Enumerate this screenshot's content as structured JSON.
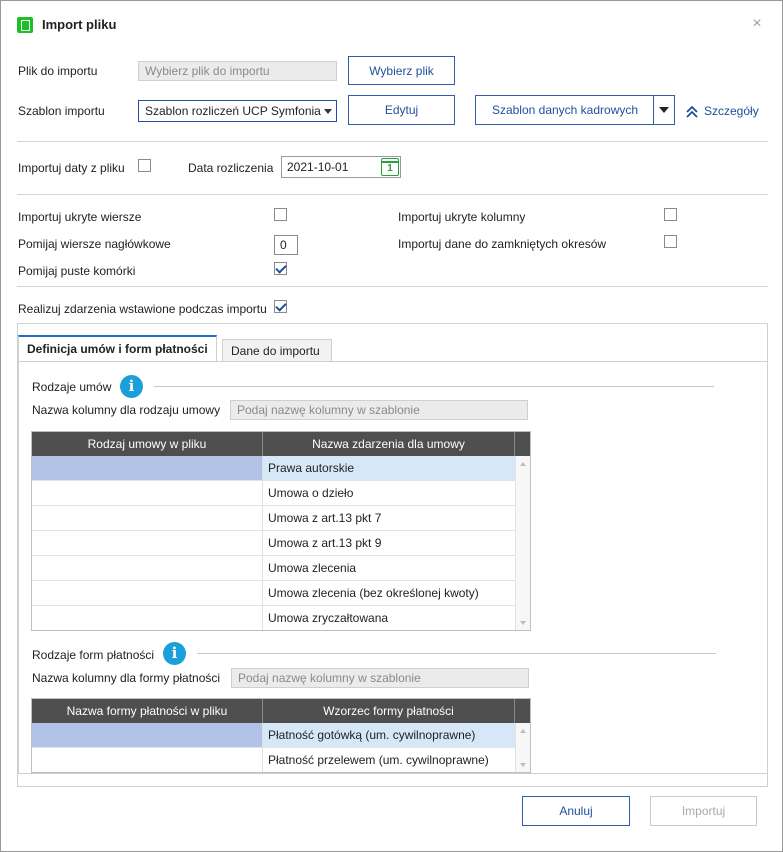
{
  "window": {
    "title": "Import pliku",
    "close_glyph": "×",
    "icon": "app-import-icon"
  },
  "file": {
    "label": "Plik do importu",
    "placeholder": "Wybierz plik do importu",
    "choose_button": "Wybierz plik"
  },
  "template": {
    "label": "Szablon importu",
    "selected": "Szablon rozliczeń UCP Symfonia",
    "edit_button": "Edytuj",
    "hr_template_button": "Szablon danych kadrowych",
    "details_link": "Szczegóły"
  },
  "dates": {
    "import_dates_label": "Importuj daty z pliku",
    "import_dates_checked": false,
    "settlement_date_label": "Data rozliczenia",
    "settlement_date": "2021-10-01",
    "calendar_day": "1"
  },
  "options": {
    "hidden_rows_label": "Importuj ukryte wiersze",
    "hidden_rows_checked": false,
    "hidden_columns_label": "Importuj ukryte kolumny",
    "hidden_columns_checked": false,
    "skip_header_rows_label": "Pomijaj wiersze nagłówkowe",
    "skip_header_rows_value": "0",
    "closed_periods_label": "Importuj dane do zamkniętych okresów",
    "closed_periods_checked": false,
    "skip_empty_cells_label": "Pomijaj puste komórki",
    "skip_empty_cells_checked": true,
    "realize_events_label": "Realizuj zdarzenia wstawione podczas importu",
    "realize_events_checked": true
  },
  "tabs": [
    {
      "label": "Definicja umów i form płatności",
      "active": true
    },
    {
      "label": "Dane do importu",
      "active": false
    }
  ],
  "contracts": {
    "group_label": "Rodzaje umów",
    "column_label": "Nazwa kolumny dla rodzaju umowy",
    "column_placeholder": "Podaj nazwę kolumny w szablonie",
    "headers": [
      "Rodzaj umowy w pliku",
      "Nazwa zdarzenia dla umowy"
    ],
    "rows": [
      {
        "file_value": "",
        "event": "Prawa autorskie",
        "selected": true
      },
      {
        "file_value": "",
        "event": "Umowa o dzieło",
        "selected": false
      },
      {
        "file_value": "",
        "event": "Umowa z art.13 pkt 7",
        "selected": false
      },
      {
        "file_value": "",
        "event": "Umowa z art.13 pkt 9",
        "selected": false
      },
      {
        "file_value": "",
        "event": "Umowa zlecenia",
        "selected": false
      },
      {
        "file_value": "",
        "event": "Umowa zlecenia (bez określonej kwoty)",
        "selected": false
      },
      {
        "file_value": "",
        "event": "Umowa zryczałtowana",
        "selected": false
      }
    ]
  },
  "payments": {
    "group_label": "Rodzaje form płatności",
    "column_label": "Nazwa kolumny dla formy płatności",
    "column_placeholder": "Podaj nazwę kolumny w szablonie",
    "headers": [
      "Nazwa formy płatności w pliku",
      "Wzorzec formy płatności"
    ],
    "rows": [
      {
        "file_value": "",
        "pattern": "Płatność gotówką (um. cywilnoprawne)",
        "selected": true
      },
      {
        "file_value": "",
        "pattern": "Płatność przelewem (um. cywilnoprawne)",
        "selected": false
      }
    ]
  },
  "footer": {
    "cancel_button": "Anuluj",
    "import_button": "Importuj"
  },
  "colors": {
    "accent": "#1f4f9e",
    "selection_left": "#b3c3e8",
    "selection_right": "#d6e8f7",
    "header_bg": "#4e4e4e",
    "info": "#1a9fd8",
    "app_icon": "#1fbf2a"
  }
}
